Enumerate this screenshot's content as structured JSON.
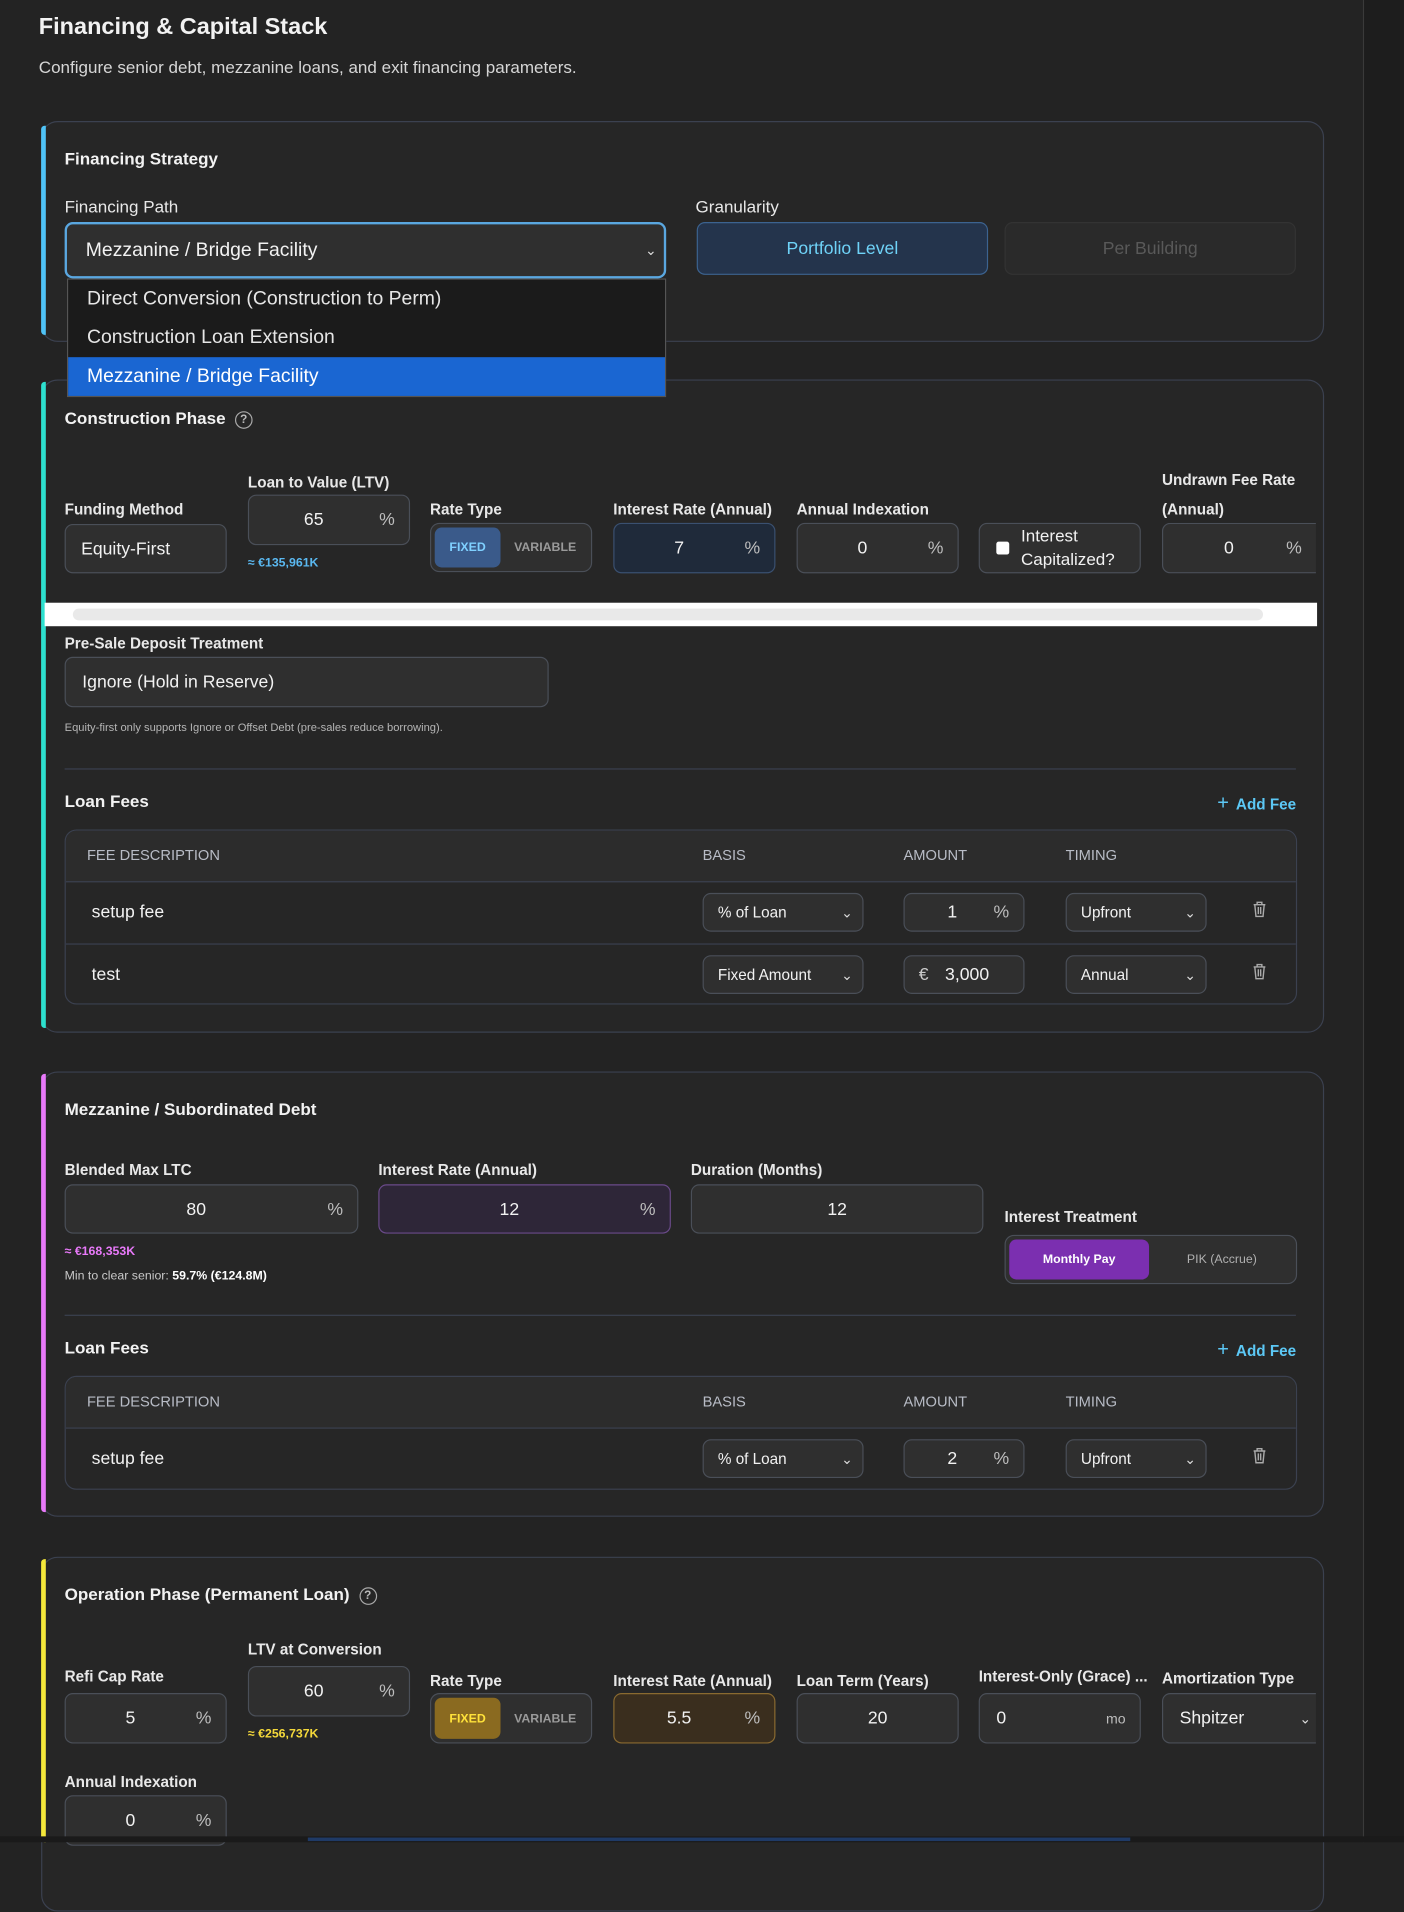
{
  "header": {
    "title": "Financing & Capital Stack",
    "subtitle": "Configure senior debt, mezzanine loans, and exit financing parameters."
  },
  "strategy": {
    "title": "Financing Strategy",
    "path_label": "Financing Path",
    "path_value": "Mezzanine / Bridge Facility",
    "path_options": [
      "Direct Conversion (Construction to Perm)",
      "Construction Loan Extension",
      "Mezzanine / Bridge Facility"
    ],
    "granularity_label": "Granularity",
    "granularity_options": [
      "Portfolio Level",
      "Per Building"
    ],
    "granularity_selected": "Portfolio Level"
  },
  "construction": {
    "title": "Construction Phase",
    "funding_method_label": "Funding Method",
    "funding_method": "Equity-First",
    "ltv_label": "Loan to Value (LTV)",
    "ltv": "65",
    "ltv_hint": "≈ €135,961K",
    "rate_type_label": "Rate Type",
    "rate_types": [
      "FIXED",
      "VARIABLE"
    ],
    "rate_type_selected": "FIXED",
    "interest_label": "Interest Rate (Annual)",
    "interest": "7",
    "indexation_label": "Annual Indexation",
    "indexation": "0",
    "capitalized_label": "Interest Capitalized?",
    "capitalized": false,
    "undrawn_label_1": "Undrawn Fee Rate",
    "undrawn_label_2": "(Annual)",
    "undrawn": "0",
    "presale_label": "Pre-Sale Deposit Treatment",
    "presale": "Ignore (Hold in Reserve)",
    "presale_note": "Equity-first only supports Ignore or Offset Debt (pre-sales reduce borrowing).",
    "fees_title": "Loan Fees",
    "add_fee": "Add Fee",
    "fees": [
      {
        "desc": "setup fee",
        "basis": "% of Loan",
        "prefix": "",
        "amount": "1",
        "suffix": "%",
        "timing": "Upfront"
      },
      {
        "desc": "test",
        "basis": "Fixed Amount",
        "prefix": "€",
        "amount": "3,000",
        "suffix": "",
        "timing": "Annual"
      }
    ]
  },
  "table_headers": {
    "desc": "FEE DESCRIPTION",
    "basis": "BASIS",
    "amount": "AMOUNT",
    "timing": "TIMING"
  },
  "mezz": {
    "title": "Mezzanine / Subordinated Debt",
    "ltc_label": "Blended Max LTC",
    "ltc": "80",
    "ltc_hint": "≈ €168,353K",
    "min_clear_label": "Min to clear senior:",
    "min_clear_value": "59.7% (€124.8M)",
    "interest_label": "Interest Rate (Annual)",
    "interest": "12",
    "duration_label": "Duration (Months)",
    "duration": "12",
    "treatment_label": "Interest Treatment",
    "treatments": [
      "Monthly Pay",
      "PIK (Accrue)"
    ],
    "treatment_selected": "Monthly Pay",
    "fees_title": "Loan Fees",
    "add_fee": "Add Fee",
    "fees": [
      {
        "desc": "setup fee",
        "basis": "% of Loan",
        "amount": "2",
        "suffix": "%",
        "timing": "Upfront"
      }
    ]
  },
  "operation": {
    "title": "Operation Phase (Permanent Loan)",
    "cap_label": "Refi Cap Rate",
    "cap": "5",
    "ltv_label": "LTV at Conversion",
    "ltv": "60",
    "ltv_hint": "≈ €256,737K",
    "rate_type_label": "Rate Type",
    "rate_types": [
      "FIXED",
      "VARIABLE"
    ],
    "rate_type_selected": "FIXED",
    "interest_label": "Interest Rate (Annual)",
    "interest": "5.5",
    "term_label": "Loan Term (Years)",
    "term": "20",
    "io_label": "Interest-Only (Grace) ...",
    "io": "0",
    "io_unit": "mo",
    "amort_label": "Amortization Type",
    "amort": "Shpitzer",
    "indexation_label": "Annual Indexation",
    "indexation": "0"
  },
  "units": {
    "percent": "%",
    "plus": "+",
    "help": "?",
    "chevron": "⌄"
  },
  "colors": {
    "strategy": "#4fc3f7",
    "construction": "#2de0cf",
    "mezz": "#e879f9",
    "operation": "#f5e83a"
  }
}
